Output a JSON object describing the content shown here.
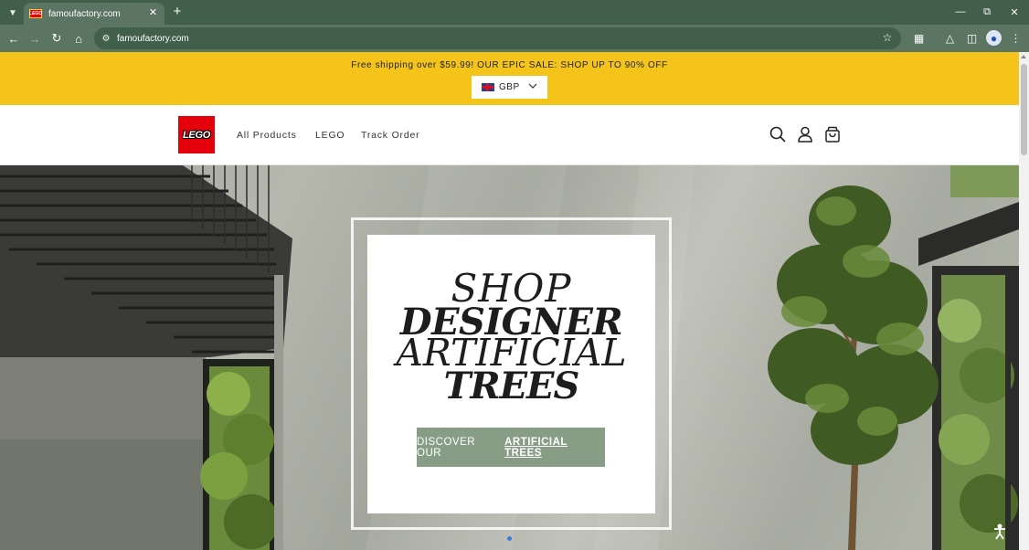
{
  "browser": {
    "tab_title": "famoufactory.com",
    "url": "famoufactory.com",
    "favicon_text": "LEGO"
  },
  "announcement": {
    "text": "Free shipping over $59.99! OUR EPIC SALE: SHOP UP TO 90% OFF",
    "currency": "GBP",
    "background": "#f4c41b"
  },
  "header": {
    "logo_text": "LEGO",
    "nav": [
      "All Products",
      "LEGO",
      "Track Order"
    ],
    "icons": [
      "search-icon",
      "account-icon",
      "cart-icon"
    ]
  },
  "hero": {
    "headline_1": "SHOP",
    "headline_2": "DESIGNER",
    "headline_3": "ARTIFICIAL",
    "headline_4": "TREES",
    "cta_prefix": "DISCOVER OUR",
    "cta_emphasis": "ARTIFICIAL TREES",
    "cta_color": "#879d85"
  }
}
